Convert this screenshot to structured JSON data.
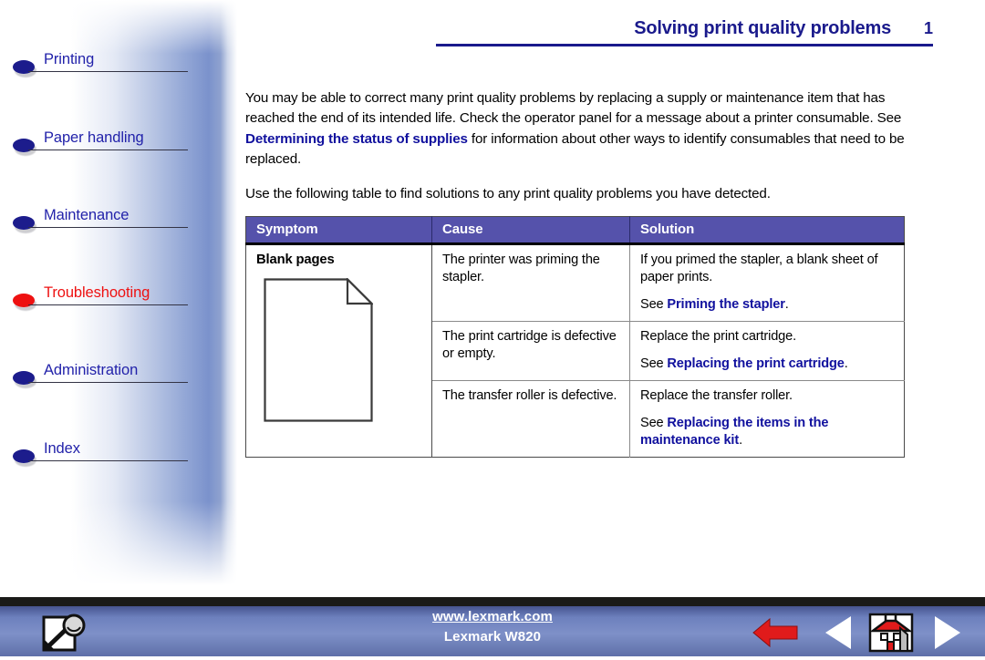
{
  "sidebar": {
    "items": [
      {
        "label": "Printing",
        "icon": "bullet-icon",
        "active": false
      },
      {
        "label": "Paper handling",
        "icon": "bullet-icon",
        "active": false
      },
      {
        "label": "Maintenance",
        "icon": "bullet-icon",
        "active": false
      },
      {
        "label": "Troubleshooting",
        "icon": "bullet-icon",
        "active": true
      },
      {
        "label": "Administration",
        "icon": "bullet-icon",
        "active": false
      },
      {
        "label": "Index",
        "icon": "bullet-icon",
        "active": false
      }
    ],
    "active_color": "#ee1111",
    "link_color": "#2222aa"
  },
  "header": {
    "title": "Solving print quality problems",
    "page_number": "1",
    "color": "#1a1a8c"
  },
  "body": {
    "paragraph1_part1": "You may be able to correct many print quality problems by replacing a supply or maintenance item that has reached the end of its intended life. Check the operator panel for a message about a printer consumable. See ",
    "paragraph1_link": "Determining the status of supplies",
    "paragraph1_part2": " for information about other ways to identify consumables that need to be replaced.",
    "paragraph2": "Use the following table to find solutions to any print quality problems you have detected."
  },
  "table": {
    "headers": [
      "Symptom",
      "Cause",
      "Solution"
    ],
    "header_bg": "#5552ab",
    "symptom": {
      "title": "Blank pages",
      "icon": "blank-page-icon"
    },
    "rows": [
      {
        "cause": "The printer was priming the stapler.",
        "solution_line1": "If you primed the stapler, a blank sheet of paper prints.",
        "solution_see": "See ",
        "solution_link": "Priming the stapler",
        "solution_period": "."
      },
      {
        "cause": "The print cartridge is defective or empty.",
        "solution_line1": "Replace the print cartridge.",
        "solution_see": "See ",
        "solution_link": "Replacing the print cartridge",
        "solution_period": "."
      },
      {
        "cause": "The transfer roller is defective.",
        "solution_line1": "Replace the transfer roller.",
        "solution_see": "See ",
        "solution_link": "Replacing the items in the maintenance kit",
        "solution_period": "."
      }
    ],
    "link_color": "#11119e"
  },
  "footer": {
    "url": "www.lexmark.com",
    "model": "Lexmark W820",
    "search_icon": "search-page-icon",
    "buttons": [
      {
        "name": "back-arrow-icon",
        "color": "#e01b1b"
      },
      {
        "name": "previous-page-icon",
        "color": "#ffffff"
      },
      {
        "name": "home-icon",
        "color": "#e01b1b"
      },
      {
        "name": "next-page-icon",
        "color": "#ffffff"
      }
    ],
    "background": "#6d80bd"
  }
}
